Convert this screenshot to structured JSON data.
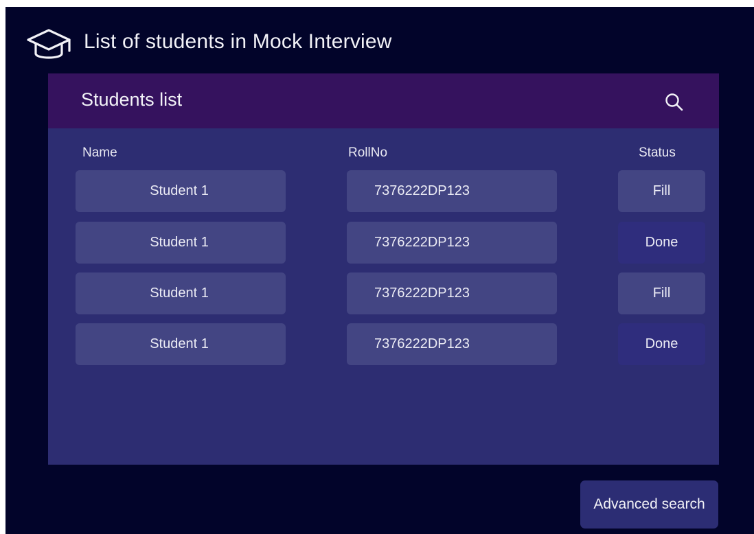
{
  "app": {
    "title": "List of students in Mock Interview",
    "icon": "graduation-cap-icon"
  },
  "panel": {
    "title": "Students list",
    "search_icon": "search-icon",
    "columns": [
      "Name",
      "RollNo",
      "Status"
    ],
    "rows": [
      {
        "name": "Student 1",
        "roll": "7376222DP123",
        "status": "Fill"
      },
      {
        "name": "Student 1",
        "roll": "7376222DP123",
        "status": "Done"
      },
      {
        "name": "Student 1",
        "roll": "7376222DP123",
        "status": "Fill"
      },
      {
        "name": "Student 1",
        "roll": "7376222DP123",
        "status": "Done"
      }
    ]
  },
  "actions": {
    "advanced_search_label": "Advanced search"
  },
  "colors": {
    "background": "#02042a",
    "panel": "#2d2d72",
    "panel_header": "#35125e",
    "cell": "#434583",
    "status_done": "#2f2d7d",
    "text": "#f2f2f7"
  }
}
